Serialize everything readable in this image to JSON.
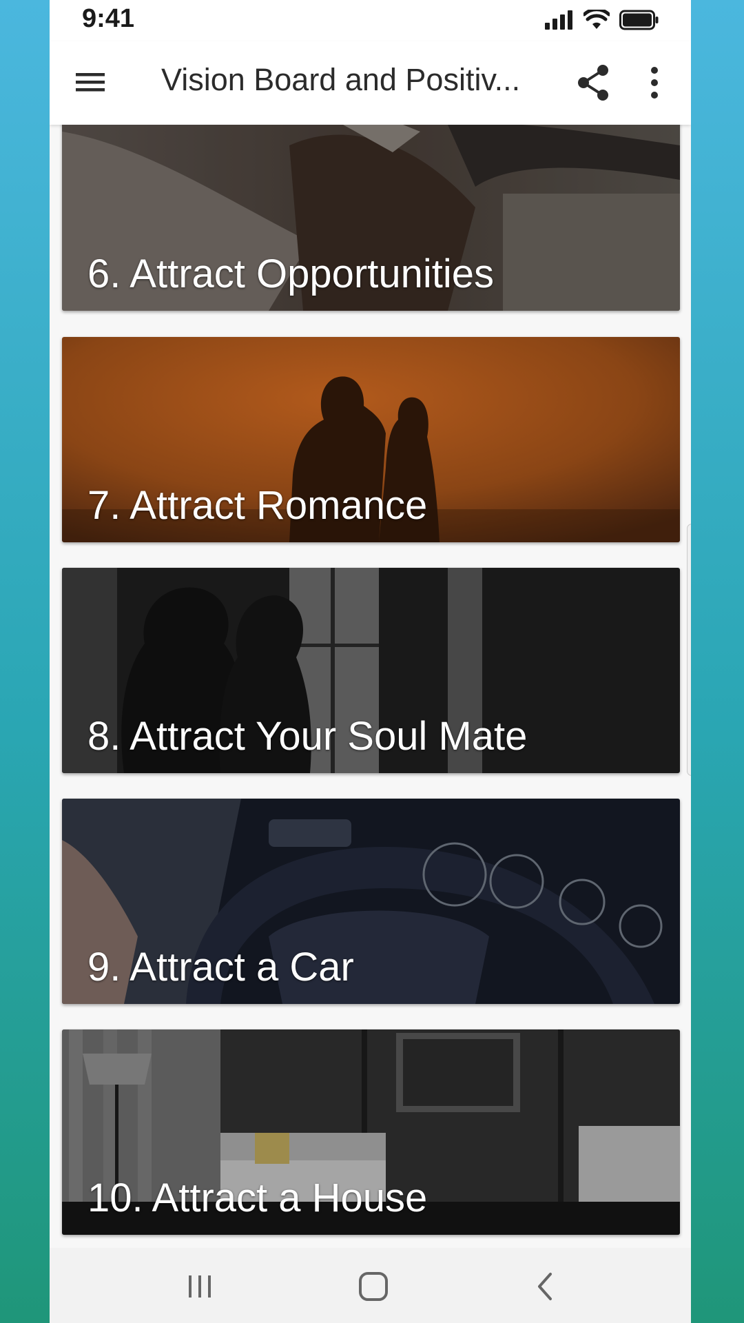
{
  "status_bar": {
    "time": "9:41"
  },
  "app_bar": {
    "title": "Vision Board and Positiv..."
  },
  "cards": [
    {
      "label": "6. Attract Opportunities"
    },
    {
      "label": "7. Attract Romance"
    },
    {
      "label": "8. Attract Your Soul Mate"
    },
    {
      "label": "9. Attract a Car"
    },
    {
      "label": "10. Attract a House"
    }
  ],
  "icons": {
    "menu": "hamburger-menu-icon",
    "share": "share-icon",
    "more": "more-vertical-icon",
    "recents": "recent-apps-icon",
    "home": "home-icon",
    "back": "back-icon"
  },
  "colors": {
    "background_top": "#4bb7de",
    "background_bottom": "#1f9679",
    "app_bar": "#ffffff",
    "card_text": "#ffffff"
  }
}
